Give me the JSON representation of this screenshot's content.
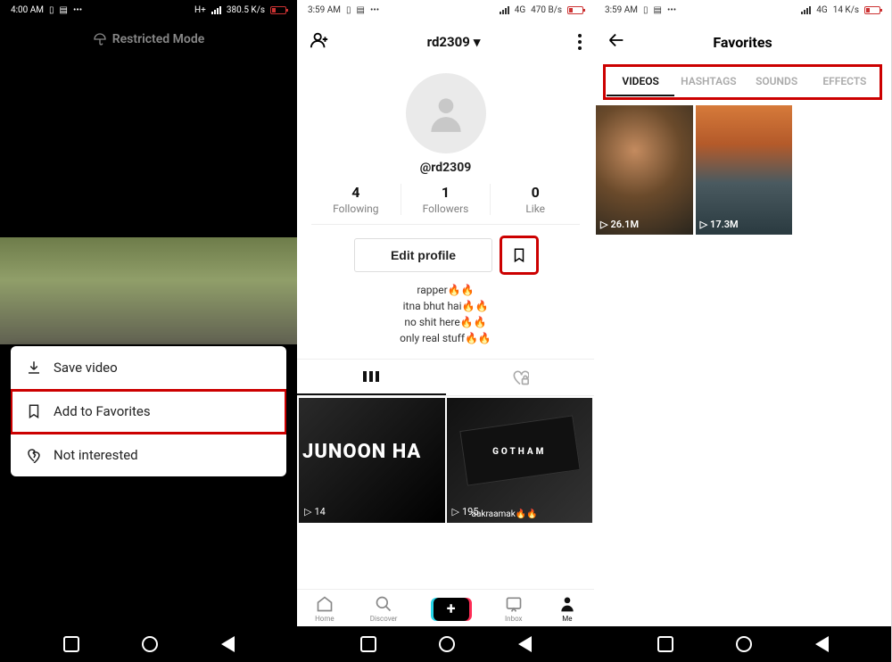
{
  "panel1": {
    "status": {
      "time": "4:00 AM",
      "net_rate": "380.5 K/s",
      "network": "H+"
    },
    "restricted_label": "Restricted Mode",
    "menu": {
      "save": "Save video",
      "favorite": "Add to Favorites",
      "not_interested": "Not interested"
    }
  },
  "panel2": {
    "status": {
      "time": "3:59 AM",
      "net_rate": "470 B/s",
      "network": "4G"
    },
    "header": {
      "name": "rd2309"
    },
    "username": "@rd2309",
    "stats": {
      "following": {
        "value": "4",
        "label": "Following"
      },
      "followers": {
        "value": "1",
        "label": "Followers"
      },
      "like": {
        "value": "0",
        "label": "Like"
      }
    },
    "edit_profile": "Edit profile",
    "bio": {
      "l1": "rapper🔥🔥",
      "l2": "itna bhut hai🔥🔥",
      "l3": "no shit here🔥🔥",
      "l4": "only real stuff🔥🔥"
    },
    "feed": {
      "item1": {
        "text": "JUNOON HA",
        "views": "14"
      },
      "item2": {
        "text": "GOTHAM",
        "views": "195",
        "caption": "aakraamak🔥🔥"
      }
    },
    "bottom": {
      "home": "Home",
      "discover": "Discover",
      "inbox": "Inbox",
      "me": "Me"
    }
  },
  "panel3": {
    "status": {
      "time": "3:59 AM",
      "net_rate": "14 K/s",
      "network": "4G"
    },
    "title": "Favorites",
    "tabs": {
      "videos": "VIDEOS",
      "hashtags": "HASHTAGS",
      "sounds": "SOUNDS",
      "effects": "EFFECTS"
    },
    "grid": {
      "item1": {
        "views": "26.1M"
      },
      "item2": {
        "views": "17.3M"
      }
    }
  }
}
